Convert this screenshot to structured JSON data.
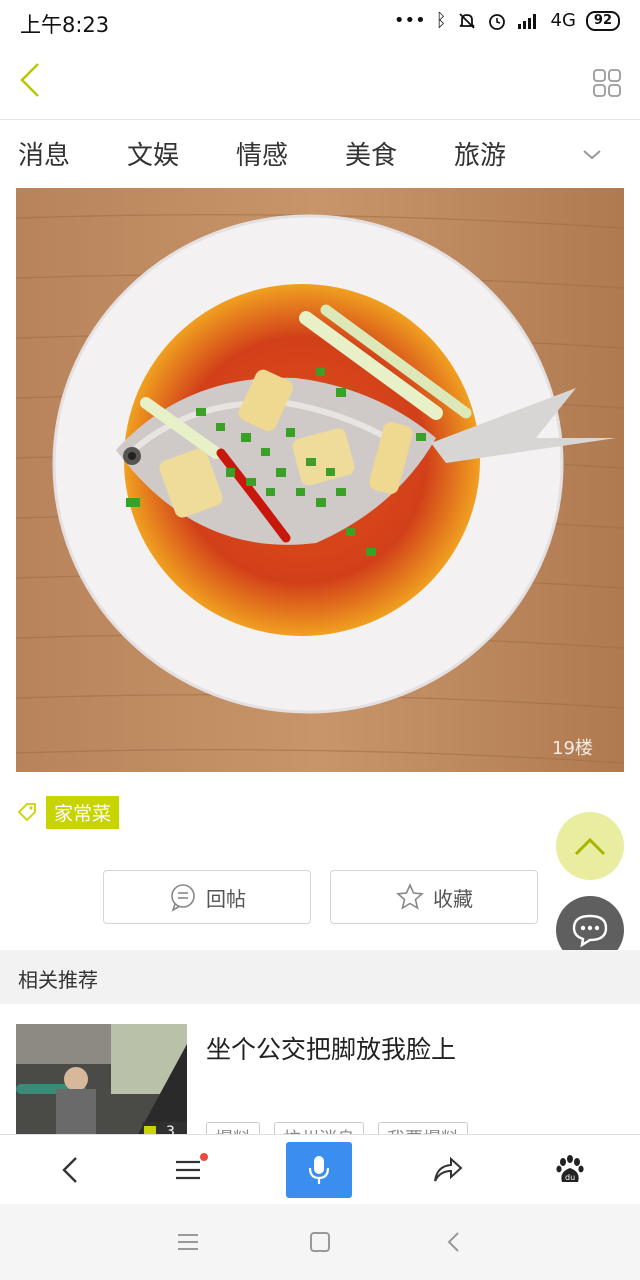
{
  "status_bar": {
    "time": "上午8:23",
    "network": "4G",
    "battery": "92"
  },
  "nav": {
    "back_icon": "chevron-left-icon",
    "menu_icon": "grid-icon"
  },
  "tabs": [
    {
      "label": "消息"
    },
    {
      "label": "文娱"
    },
    {
      "label": "情感"
    },
    {
      "label": "美食"
    },
    {
      "label": "旅游"
    }
  ],
  "hero": {
    "watermark": "19楼"
  },
  "tag": {
    "label": "家常菜"
  },
  "actions": {
    "reply_label": "回帖",
    "favorite_label": "收藏"
  },
  "related": {
    "header": "相关推荐",
    "item": {
      "title": "坐个公交把脚放我脸上",
      "image_count": "3",
      "tags": [
        "爆料",
        "杭州消息",
        "我要爆料"
      ]
    }
  },
  "colors": {
    "accent": "#c8d400",
    "mic_blue": "#3a8ef0",
    "fab_light": "#e8eda0",
    "fab_dark": "#5f5f5f"
  }
}
